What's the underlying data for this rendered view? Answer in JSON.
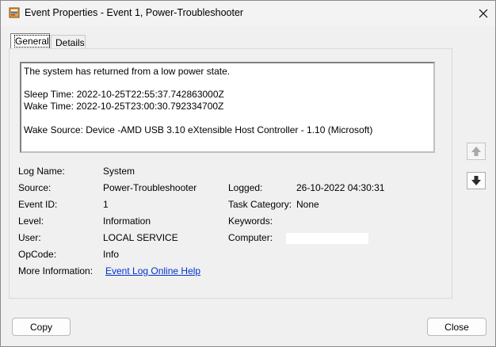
{
  "window": {
    "title": "Event Properties - Event 1, Power-Troubleshooter",
    "icon": "event-viewer-icon",
    "close_glyph": "✕"
  },
  "tabs": [
    {
      "label": "General",
      "active": true
    },
    {
      "label": "Details",
      "active": false
    }
  ],
  "description": {
    "line1": "The system has returned from a low power state.",
    "line2": "Sleep Time: 2022-10-25T22:55:37.742863000Z",
    "line3": "Wake Time: 2022-10-25T23:00:30.792334700Z",
    "line4": "Wake Source: Device -AMD USB 3.10 eXtensible Host Controller - 1.10 (Microsoft)"
  },
  "fields": {
    "log_name_label": "Log Name:",
    "log_name_value": "System",
    "source_label": "Source:",
    "source_value": "Power-Troubleshooter",
    "logged_label": "Logged:",
    "logged_value": "26-10-2022 04:30:31",
    "event_id_label": "Event ID:",
    "event_id_value": "1",
    "task_category_label": "Task Category:",
    "task_category_value": "None",
    "level_label": "Level:",
    "level_value": "Information",
    "keywords_label": "Keywords:",
    "keywords_value": "",
    "user_label": "User:",
    "user_value": "LOCAL SERVICE",
    "computer_label": "Computer:",
    "opcode_label": "OpCode:",
    "opcode_value": "Info",
    "more_info_label": "More Information:",
    "more_info_link": "Event Log Online Help"
  },
  "buttons": {
    "copy": "Copy",
    "close": "Close"
  },
  "colors": {
    "link": "#0033cc",
    "background": "#f0f0f0"
  }
}
